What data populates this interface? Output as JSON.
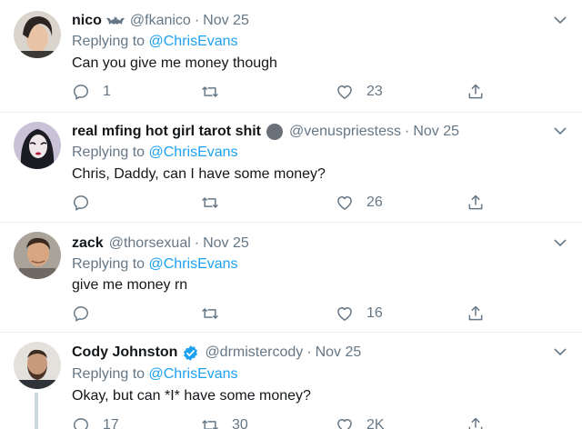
{
  "tweets": [
    {
      "name": "nico",
      "handle": "@fkanico",
      "date": "Nov 25",
      "replying_label": "Replying to",
      "replying_to": "@ChrisEvans",
      "text": "Can you give me money though",
      "reply_count": "1",
      "retweet_count": "",
      "like_count": "23"
    },
    {
      "name": "real mfing hot girl tarot shit",
      "handle": "@venuspriestess",
      "date": "Nov 25",
      "replying_label": "Replying to",
      "replying_to": "@ChrisEvans",
      "text": "Chris, Daddy, can I have some money?",
      "reply_count": "",
      "retweet_count": "",
      "like_count": "26"
    },
    {
      "name": "zack",
      "handle": "@thorsexual",
      "date": "Nov 25",
      "replying_label": "Replying to",
      "replying_to": "@ChrisEvans",
      "text": "give me money rn",
      "reply_count": "",
      "retweet_count": "",
      "like_count": "16"
    },
    {
      "name": "Cody Johnston",
      "handle": "@drmistercody",
      "date": "Nov 25",
      "replying_label": "Replying to",
      "replying_to": "@ChrisEvans",
      "text": "Okay, but can *I* have some money?",
      "reply_count": "17",
      "retweet_count": "30",
      "like_count": "2K"
    }
  ],
  "separator": "·",
  "colors": {
    "text_primary": "#14171a",
    "text_secondary": "#657786",
    "link": "#1da1f2",
    "divider": "#e6ecf0",
    "verified": "#1da1f2"
  },
  "icons": {
    "reply": "reply-icon",
    "retweet": "retweet-icon",
    "like": "like-icon",
    "share": "share-icon",
    "caret": "chevron-down-icon",
    "verified": "verified-badge-icon"
  }
}
